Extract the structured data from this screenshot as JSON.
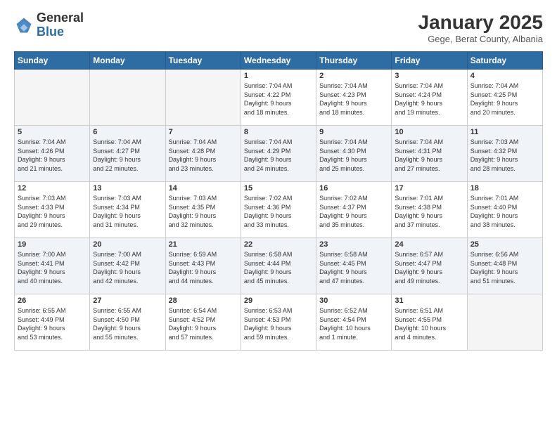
{
  "logo": {
    "general": "General",
    "blue": "Blue"
  },
  "header": {
    "month": "January 2025",
    "location": "Gege, Berat County, Albania"
  },
  "weekdays": [
    "Sunday",
    "Monday",
    "Tuesday",
    "Wednesday",
    "Thursday",
    "Friday",
    "Saturday"
  ],
  "weeks": [
    [
      {
        "day": "",
        "info": ""
      },
      {
        "day": "",
        "info": ""
      },
      {
        "day": "",
        "info": ""
      },
      {
        "day": "1",
        "info": "Sunrise: 7:04 AM\nSunset: 4:22 PM\nDaylight: 9 hours\nand 18 minutes."
      },
      {
        "day": "2",
        "info": "Sunrise: 7:04 AM\nSunset: 4:23 PM\nDaylight: 9 hours\nand 18 minutes."
      },
      {
        "day": "3",
        "info": "Sunrise: 7:04 AM\nSunset: 4:24 PM\nDaylight: 9 hours\nand 19 minutes."
      },
      {
        "day": "4",
        "info": "Sunrise: 7:04 AM\nSunset: 4:25 PM\nDaylight: 9 hours\nand 20 minutes."
      }
    ],
    [
      {
        "day": "5",
        "info": "Sunrise: 7:04 AM\nSunset: 4:26 PM\nDaylight: 9 hours\nand 21 minutes."
      },
      {
        "day": "6",
        "info": "Sunrise: 7:04 AM\nSunset: 4:27 PM\nDaylight: 9 hours\nand 22 minutes."
      },
      {
        "day": "7",
        "info": "Sunrise: 7:04 AM\nSunset: 4:28 PM\nDaylight: 9 hours\nand 23 minutes."
      },
      {
        "day": "8",
        "info": "Sunrise: 7:04 AM\nSunset: 4:29 PM\nDaylight: 9 hours\nand 24 minutes."
      },
      {
        "day": "9",
        "info": "Sunrise: 7:04 AM\nSunset: 4:30 PM\nDaylight: 9 hours\nand 25 minutes."
      },
      {
        "day": "10",
        "info": "Sunrise: 7:04 AM\nSunset: 4:31 PM\nDaylight: 9 hours\nand 27 minutes."
      },
      {
        "day": "11",
        "info": "Sunrise: 7:03 AM\nSunset: 4:32 PM\nDaylight: 9 hours\nand 28 minutes."
      }
    ],
    [
      {
        "day": "12",
        "info": "Sunrise: 7:03 AM\nSunset: 4:33 PM\nDaylight: 9 hours\nand 29 minutes."
      },
      {
        "day": "13",
        "info": "Sunrise: 7:03 AM\nSunset: 4:34 PM\nDaylight: 9 hours\nand 31 minutes."
      },
      {
        "day": "14",
        "info": "Sunrise: 7:03 AM\nSunset: 4:35 PM\nDaylight: 9 hours\nand 32 minutes."
      },
      {
        "day": "15",
        "info": "Sunrise: 7:02 AM\nSunset: 4:36 PM\nDaylight: 9 hours\nand 33 minutes."
      },
      {
        "day": "16",
        "info": "Sunrise: 7:02 AM\nSunset: 4:37 PM\nDaylight: 9 hours\nand 35 minutes."
      },
      {
        "day": "17",
        "info": "Sunrise: 7:01 AM\nSunset: 4:38 PM\nDaylight: 9 hours\nand 37 minutes."
      },
      {
        "day": "18",
        "info": "Sunrise: 7:01 AM\nSunset: 4:40 PM\nDaylight: 9 hours\nand 38 minutes."
      }
    ],
    [
      {
        "day": "19",
        "info": "Sunrise: 7:00 AM\nSunset: 4:41 PM\nDaylight: 9 hours\nand 40 minutes."
      },
      {
        "day": "20",
        "info": "Sunrise: 7:00 AM\nSunset: 4:42 PM\nDaylight: 9 hours\nand 42 minutes."
      },
      {
        "day": "21",
        "info": "Sunrise: 6:59 AM\nSunset: 4:43 PM\nDaylight: 9 hours\nand 44 minutes."
      },
      {
        "day": "22",
        "info": "Sunrise: 6:58 AM\nSunset: 4:44 PM\nDaylight: 9 hours\nand 45 minutes."
      },
      {
        "day": "23",
        "info": "Sunrise: 6:58 AM\nSunset: 4:45 PM\nDaylight: 9 hours\nand 47 minutes."
      },
      {
        "day": "24",
        "info": "Sunrise: 6:57 AM\nSunset: 4:47 PM\nDaylight: 9 hours\nand 49 minutes."
      },
      {
        "day": "25",
        "info": "Sunrise: 6:56 AM\nSunset: 4:48 PM\nDaylight: 9 hours\nand 51 minutes."
      }
    ],
    [
      {
        "day": "26",
        "info": "Sunrise: 6:55 AM\nSunset: 4:49 PM\nDaylight: 9 hours\nand 53 minutes."
      },
      {
        "day": "27",
        "info": "Sunrise: 6:55 AM\nSunset: 4:50 PM\nDaylight: 9 hours\nand 55 minutes."
      },
      {
        "day": "28",
        "info": "Sunrise: 6:54 AM\nSunset: 4:52 PM\nDaylight: 9 hours\nand 57 minutes."
      },
      {
        "day": "29",
        "info": "Sunrise: 6:53 AM\nSunset: 4:53 PM\nDaylight: 9 hours\nand 59 minutes."
      },
      {
        "day": "30",
        "info": "Sunrise: 6:52 AM\nSunset: 4:54 PM\nDaylight: 10 hours\nand 1 minute."
      },
      {
        "day": "31",
        "info": "Sunrise: 6:51 AM\nSunset: 4:55 PM\nDaylight: 10 hours\nand 4 minutes."
      },
      {
        "day": "",
        "info": ""
      }
    ]
  ]
}
